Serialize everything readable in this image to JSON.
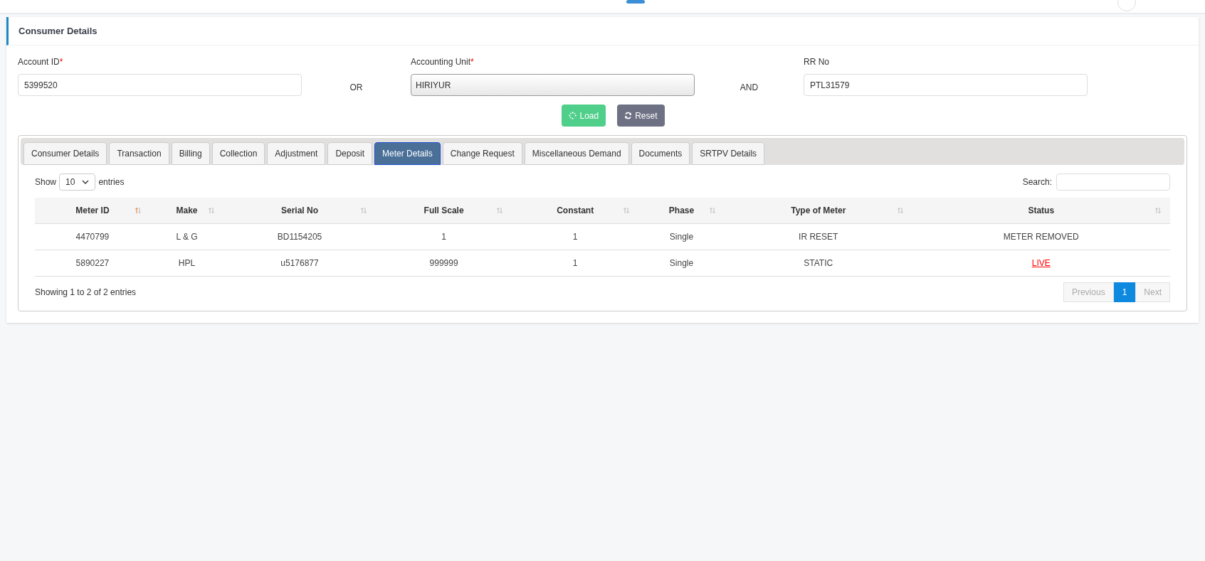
{
  "card": {
    "title": "Consumer Details"
  },
  "form": {
    "fields": [
      {
        "label": "Account ID",
        "required_mark": "*",
        "value": "5399520",
        "kind": "text"
      },
      {
        "label": "Accounting Unit",
        "required_mark": "*",
        "value": "HIRIYUR",
        "kind": "select"
      },
      {
        "label": "RR No",
        "value": "PTL31579",
        "kind": "text"
      }
    ],
    "connectors": [
      "OR",
      "AND"
    ],
    "buttons": [
      {
        "label": "Load",
        "kind": "load"
      },
      {
        "label": "Reset",
        "kind": "reset"
      }
    ]
  },
  "tabs": [
    {
      "label": "Consumer Details",
      "selected": false
    },
    {
      "label": "Transaction",
      "selected": false
    },
    {
      "label": "Billing",
      "selected": false
    },
    {
      "label": "Collection",
      "selected": false
    },
    {
      "label": "Adjustment",
      "selected": false
    },
    {
      "label": "Deposit",
      "selected": false
    },
    {
      "label": "Meter Details",
      "selected": true
    },
    {
      "label": "Change Request",
      "selected": false
    },
    {
      "label": "Miscellaneous Demand",
      "selected": false
    },
    {
      "label": "Documents",
      "selected": false
    },
    {
      "label": "SRTPV Details",
      "selected": false
    }
  ],
  "table": {
    "length": {
      "prefix": "Show",
      "value": "10",
      "suffix": "entries"
    },
    "search": {
      "label": "Search:"
    },
    "columns": [
      {
        "label": "Meter ID",
        "sorted": true
      },
      {
        "label": "Make",
        "sorted": false
      },
      {
        "label": "Serial No",
        "sorted": false
      },
      {
        "label": "Full Scale",
        "sorted": false
      },
      {
        "label": "Constant",
        "sorted": false
      },
      {
        "label": "Phase",
        "sorted": false
      },
      {
        "label": "Type of Meter",
        "sorted": false
      },
      {
        "label": "Status",
        "sorted": false
      }
    ],
    "rows": [
      {
        "cells": [
          "4470799",
          "L & G",
          "BD1154205",
          "1",
          "1",
          "Single",
          "IR RESET",
          "METER REMOVED"
        ],
        "status_link": false
      },
      {
        "cells": [
          "5890227",
          "HPL",
          "u5176877",
          "999999",
          "1",
          "Single",
          "STATIC",
          "LIVE"
        ],
        "status_link": true
      }
    ],
    "info": "Showing 1 to 2 of 2 entries",
    "pagination": [
      {
        "label": "Previous",
        "selected": false,
        "disabled": true
      },
      {
        "label": "1",
        "selected": true,
        "disabled": false
      },
      {
        "label": "Next",
        "selected": false,
        "disabled": true
      }
    ]
  }
}
